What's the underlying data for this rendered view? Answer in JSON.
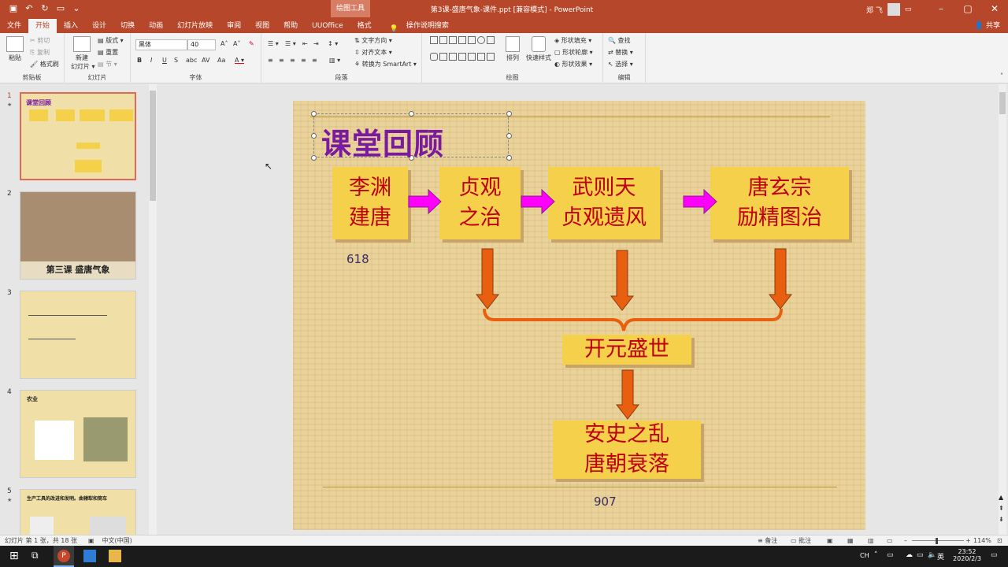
{
  "titlebar": {
    "context_label": "绘图工具",
    "doc_title": "第3课-盛唐气象-课件.ppt [兼容模式] - PowerPoint",
    "user": "郑 飞"
  },
  "tabs": [
    "文件",
    "开始",
    "插入",
    "设计",
    "切换",
    "动画",
    "幻灯片放映",
    "审阅",
    "视图",
    "帮助",
    "UUOffice",
    "格式"
  ],
  "active_tab": "开始",
  "tell_me": "操作说明搜索",
  "share": "共享",
  "ribbon": {
    "clipboard": {
      "paste": "粘贴",
      "cut": "剪切",
      "copy": "复制",
      "format_painter": "格式刷",
      "label": "剪贴板"
    },
    "slides": {
      "new_slide": "新建\n幻灯片",
      "layout": "版式",
      "reset": "重置",
      "section": "节",
      "label": "幻灯片"
    },
    "font": {
      "name": "黑体",
      "size": "40",
      "label": "字体"
    },
    "paragraph": {
      "text_direction": "文字方向",
      "align_text": "对齐文本",
      "smartart": "转换为 SmartArt",
      "label": "段落"
    },
    "drawing": {
      "arrange": "排列",
      "quick_styles": "快速样式",
      "fill": "形状填充",
      "outline": "形状轮廓",
      "effects": "形状效果",
      "label": "绘图"
    },
    "editing": {
      "find": "查找",
      "replace": "替换",
      "select": "选择",
      "label": "编辑"
    }
  },
  "thumbnails": [
    {
      "num": "1",
      "label": "课堂回顾",
      "active": true
    },
    {
      "num": "2",
      "label": "第三课 盛唐气象",
      "active": false
    },
    {
      "num": "3",
      "label": "",
      "active": false
    },
    {
      "num": "4",
      "label": "农业",
      "active": false
    },
    {
      "num": "5",
      "label": "生产工具的改进和发明。曲辕犁和筒车",
      "active": false
    }
  ],
  "slide": {
    "title": "课堂回顾",
    "boxes": [
      {
        "line1": "李渊",
        "line2": "建唐"
      },
      {
        "line1": "贞观",
        "line2": "之治"
      },
      {
        "line1": "武则天",
        "line2": "贞观遗风"
      },
      {
        "line1": "唐玄宗",
        "line2": "励精图治"
      }
    ],
    "center_box": "开元盛世",
    "bottom_box": {
      "line1": "安史之乱",
      "line2": "唐朝衰落"
    },
    "year_start": "618",
    "year_end": "907"
  },
  "statusbar": {
    "slide_info": "幻灯片 第 1 张，共 18 张",
    "language": "中文(中国)",
    "notes": "备注",
    "comments": "批注",
    "zoom": "114%"
  },
  "taskbar": {
    "time": "23:52",
    "date": "2020/2/3",
    "ime": "CH"
  },
  "colors": {
    "accent": "#b7472a",
    "box_fill": "#f5d04a",
    "box_text": "#c0000e",
    "arrow_pink": "#ff00ff",
    "arrow_orange": "#e8600f",
    "title_purple": "#7a1aa0"
  }
}
